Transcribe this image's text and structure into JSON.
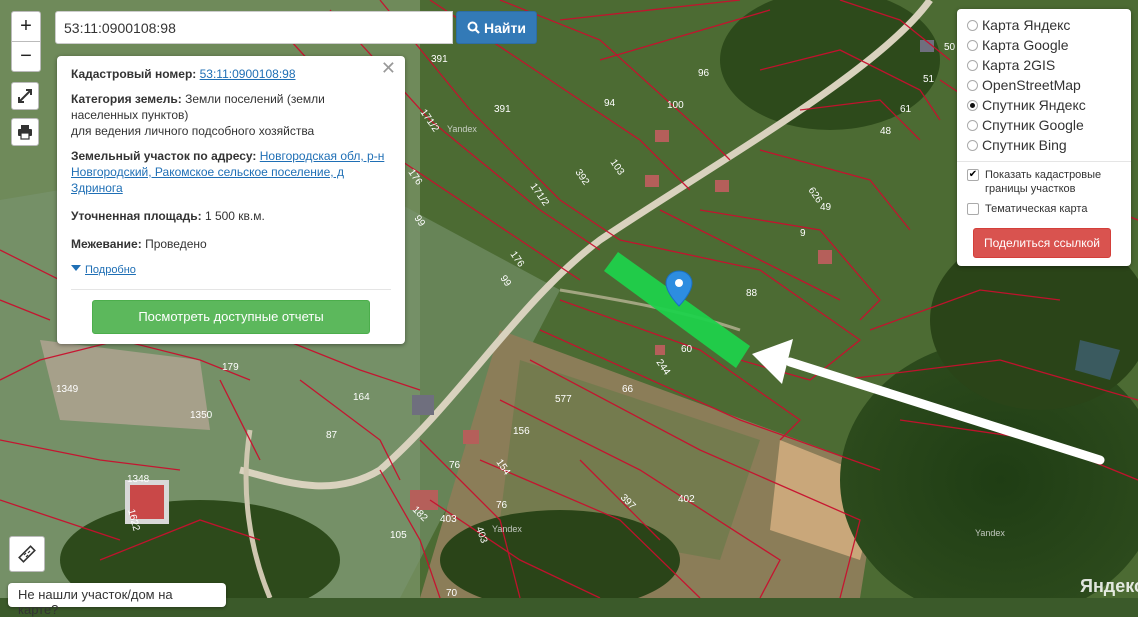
{
  "map": {
    "parcel_labels": [
      "391",
      "171/2",
      "391",
      "96",
      "94",
      "100",
      "103",
      "392",
      "171/2",
      "176",
      "99",
      "176",
      "99",
      "61",
      "48",
      "51",
      "50",
      "626",
      "49",
      "9",
      "88",
      "60",
      "244",
      "66",
      "577",
      "164",
      "179",
      "87",
      "1349",
      "1350",
      "1348",
      "1622",
      "156",
      "154",
      "76",
      "76",
      "403",
      "403",
      "182",
      "105",
      "397",
      "402",
      "70"
    ],
    "watermark": "Yandex",
    "logo": "Яндекс",
    "highlight_color": "#1fd14b",
    "marker_color": "#2d8de0",
    "boundary_color": "#c8102e"
  },
  "controls": {
    "zoom_in": "+",
    "zoom_out": "−",
    "fullscreen_icon": "fullscreen-icon",
    "print_icon": "print-icon",
    "ruler_icon": "ruler-icon"
  },
  "search": {
    "value": "53:11:0900108:98",
    "button_label": "Найти",
    "button_icon": "search-icon"
  },
  "info": {
    "cadastral_label": "Кадастровый номер:",
    "cadastral_value": "53:11:0900108:98",
    "category_label": "Категория земель:",
    "category_value": "Земли поселений (земли населенных пунктов)",
    "category_use": "для ведения личного подсобного хозяйства",
    "address_label": "Земельный участок по адресу:",
    "address_value": "Новгородская обл, р-н Новгородский, Ракомское сельское поселение, д Здринога",
    "area_label": "Уточненная площадь:",
    "area_value": "1 500 кв.м.",
    "survey_label": "Межевание:",
    "survey_value": "Проведено",
    "details_link": "Подробно",
    "reports_button": "Посмотреть доступные отчеты"
  },
  "layers": {
    "options": [
      {
        "label": "Карта Яндекс",
        "selected": false
      },
      {
        "label": "Карта Google",
        "selected": false
      },
      {
        "label": "Карта 2GIS",
        "selected": false
      },
      {
        "label": "OpenStreetMap",
        "selected": false
      },
      {
        "label": "Спутник Яндекс",
        "selected": true
      },
      {
        "label": "Спутник Google",
        "selected": false
      },
      {
        "label": "Спутник Bing",
        "selected": false
      }
    ],
    "show_boundaries_label": "Показать кадастровые границы участков",
    "show_boundaries_checked": true,
    "thematic_label": "Тематическая карта",
    "thematic_checked": false,
    "share_button": "Поделиться ссылкой"
  },
  "footer": {
    "not_found": "Не нашли участок/дом на карте?"
  }
}
